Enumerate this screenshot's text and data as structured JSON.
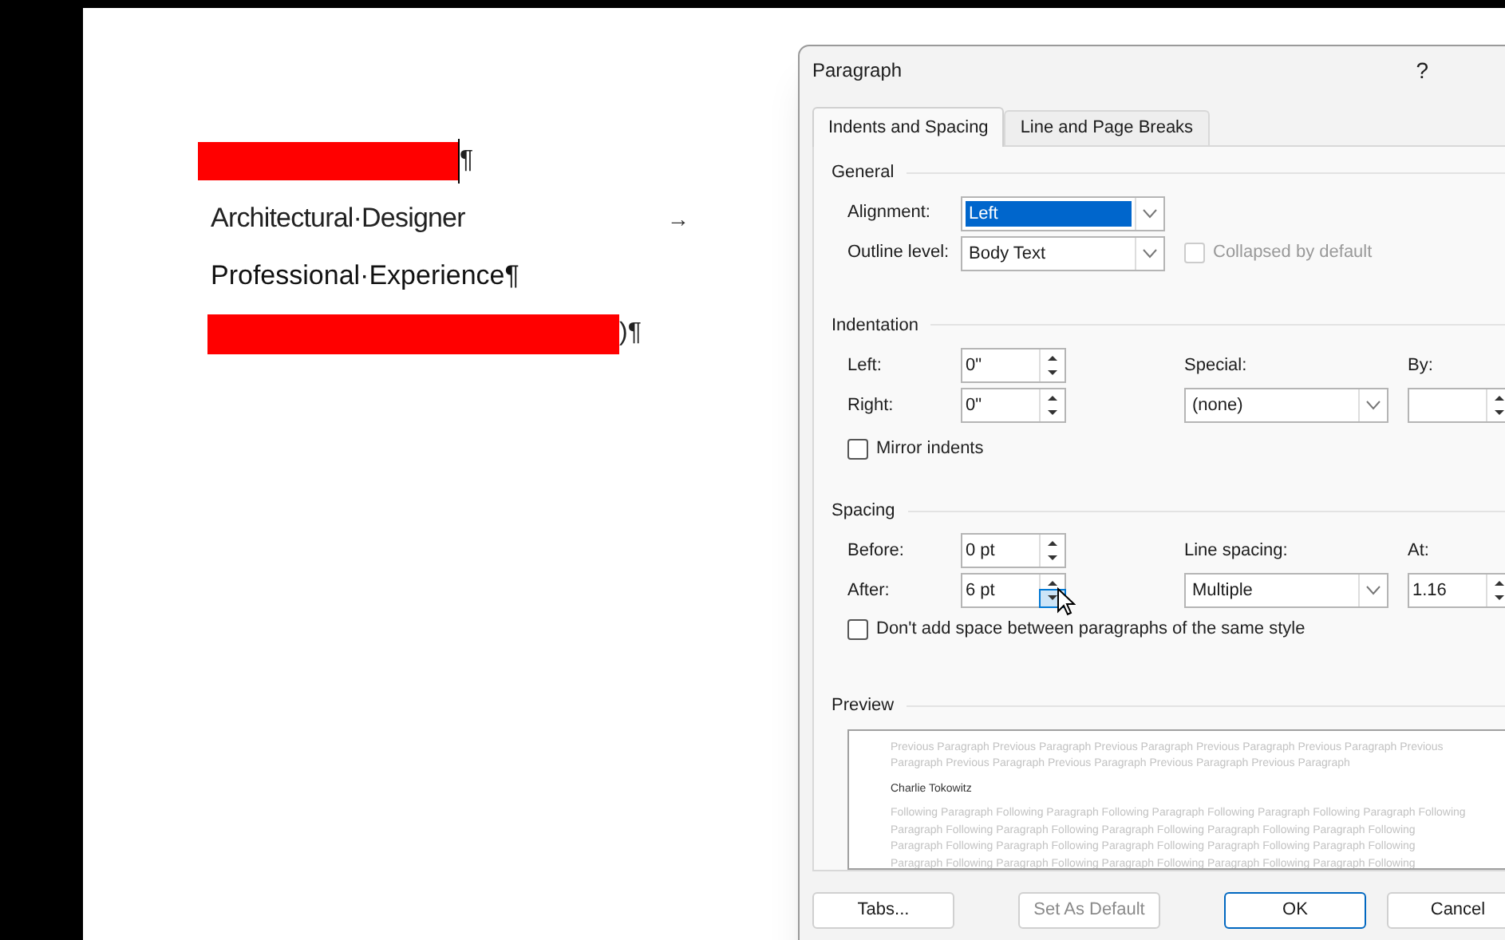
{
  "document": {
    "lines": [
      {
        "kind": "redacted",
        "suffix": "¶",
        "caret": true
      },
      {
        "kind": "text",
        "text": "Architectural·Designer",
        "trail": "→"
      },
      {
        "kind": "heading",
        "text": "Professional·Experience¶"
      },
      {
        "kind": "redacted",
        "suffix": ")¶",
        "caret": false
      }
    ]
  },
  "dialog": {
    "title": "Paragraph",
    "help": "?",
    "tabs": [
      {
        "label": "Indents and Spacing",
        "selected": true
      },
      {
        "label": "Line and Page Breaks",
        "selected": false
      }
    ],
    "general": {
      "heading": "General",
      "alignment": {
        "label": "Alignment:",
        "value": "Left"
      },
      "outline": {
        "label": "Outline level:",
        "value": "Body Text"
      },
      "collapsed": {
        "label": "Collapsed by default",
        "checked": false,
        "disabled": true
      }
    },
    "indentation": {
      "heading": "Indentation",
      "left": {
        "label": "Left:",
        "value": "0\""
      },
      "right": {
        "label": "Right:",
        "value": "0\""
      },
      "special": {
        "label": "Special:",
        "value": "(none)"
      },
      "by": {
        "label": "By:"
      },
      "mirror": {
        "label": "Mirror indents",
        "checked": false,
        "disabled": false
      }
    },
    "spacing": {
      "heading": "Spacing",
      "before": {
        "label": "Before:",
        "value": "0 pt"
      },
      "after": {
        "label": "After:",
        "value": "6 pt"
      },
      "line_spacing": {
        "label": "Line spacing:",
        "value": "Multiple"
      },
      "at": {
        "label": "At:",
        "value": "1.16"
      },
      "dont_add": {
        "label": "Don't add space between paragraphs of the same style",
        "checked": false,
        "disabled": false
      }
    },
    "preview": {
      "heading": "Preview",
      "previous": [
        "Previous Paragraph Previous Paragraph Previous Paragraph Previous Paragraph Previous Paragraph Previous",
        "Paragraph Previous Paragraph Previous Paragraph Previous Paragraph Previous Paragraph"
      ],
      "sample": "Charlie Tokowitz",
      "following": [
        "Following Paragraph Following Paragraph Following Paragraph Following Paragraph Following Paragraph Following",
        "Paragraph Following Paragraph Following Paragraph Following Paragraph Following Paragraph Following",
        "Paragraph Following Paragraph Following Paragraph Following Paragraph Following Paragraph Following",
        "Paragraph Following Paragraph Following Paragraph Following Paragraph Following Paragraph Following"
      ]
    },
    "buttons": [
      {
        "label": "Tabs...",
        "disabled": false,
        "default": false
      },
      {
        "label": "Set As Default",
        "disabled": true,
        "default": false
      },
      {
        "label": "OK",
        "disabled": false,
        "default": true
      },
      {
        "label": "Cancel",
        "disabled": false,
        "default": false
      }
    ]
  }
}
